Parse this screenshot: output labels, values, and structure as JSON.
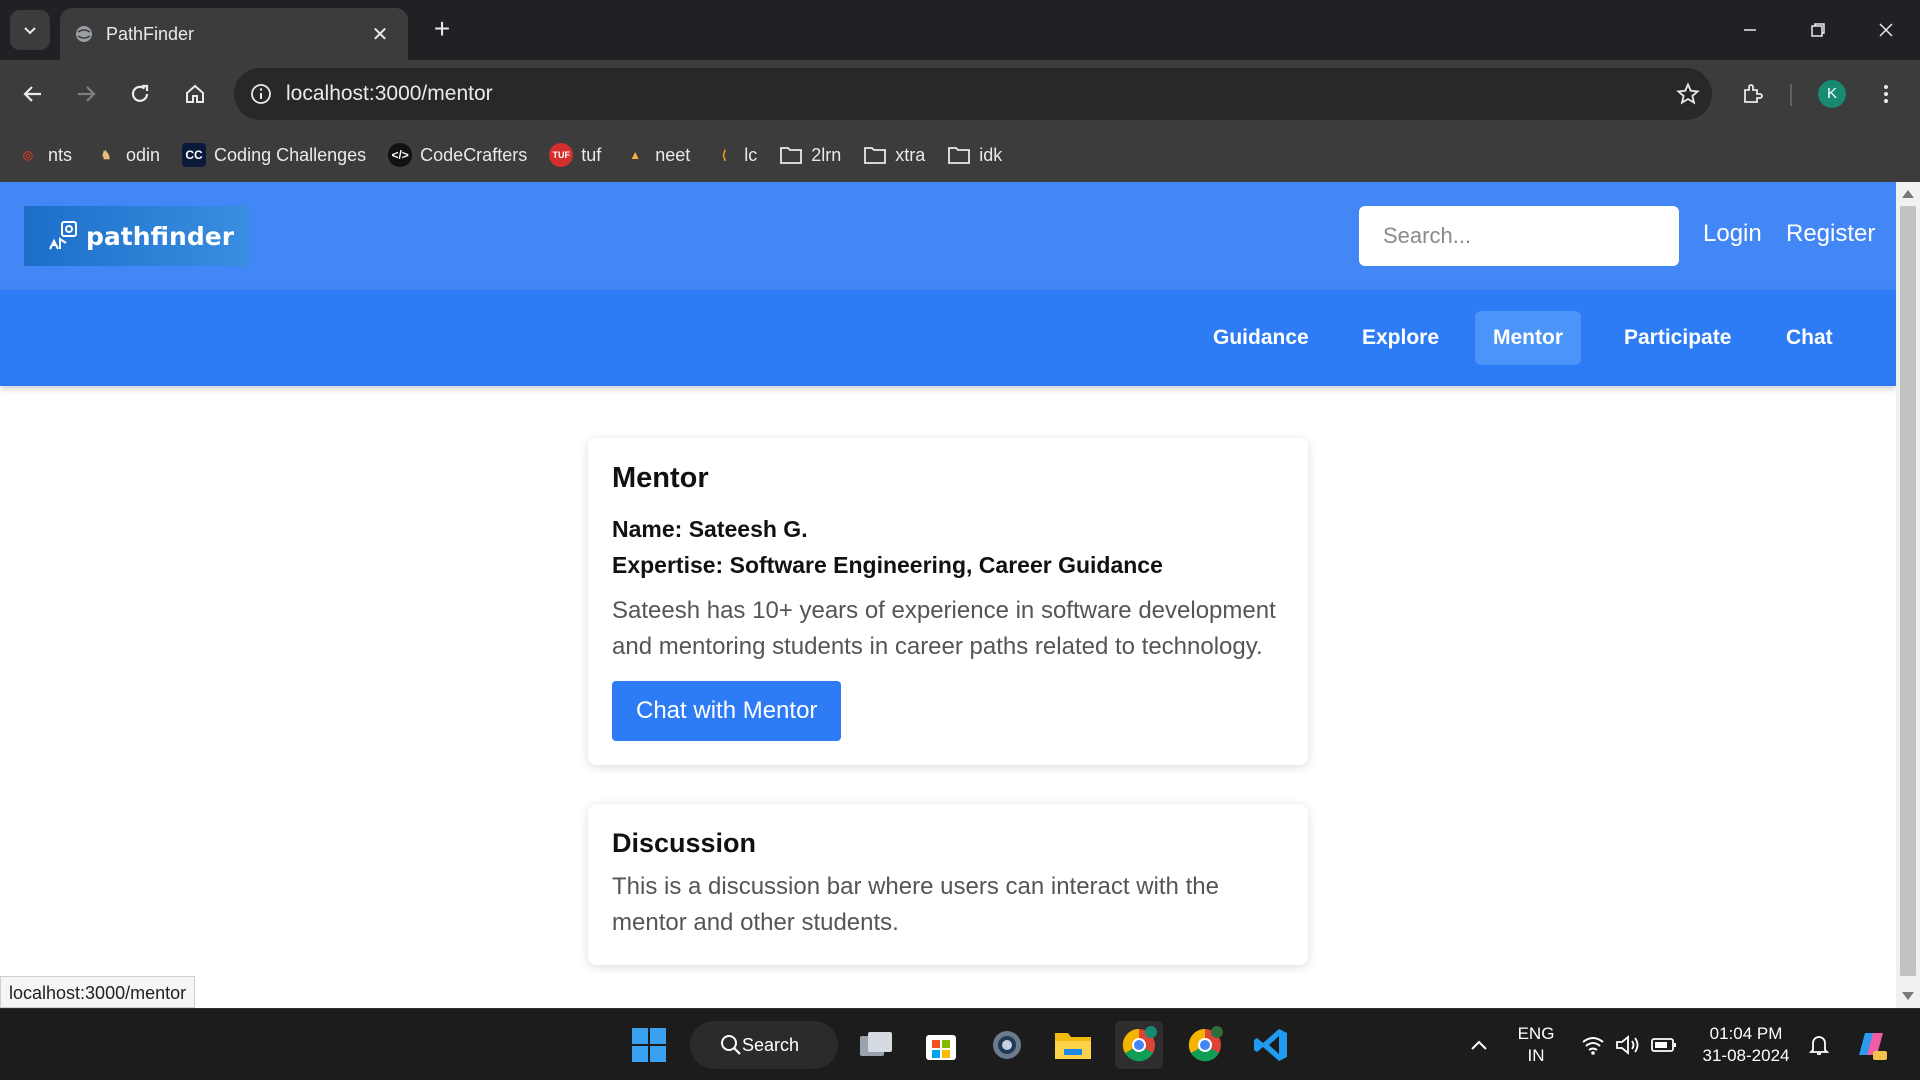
{
  "browser": {
    "tab_title": "PathFinder",
    "url": "localhost:3000/mentor",
    "profile_initial": "K",
    "bookmarks": [
      {
        "label": "nts",
        "icon": "nts-favicon"
      },
      {
        "label": "odin",
        "icon": "odin-favicon"
      },
      {
        "label": "Coding Challenges",
        "icon": "cc-favicon"
      },
      {
        "label": "CodeCrafters",
        "icon": "codecrafters-favicon"
      },
      {
        "label": "tuf",
        "icon": "tuf-favicon"
      },
      {
        "label": "neet",
        "icon": "neet-favicon"
      },
      {
        "label": "lc",
        "icon": "leetcode-favicon"
      },
      {
        "label": "2lrn",
        "icon": "folder-icon"
      },
      {
        "label": "xtra",
        "icon": "folder-icon"
      },
      {
        "label": "idk",
        "icon": "folder-icon"
      }
    ]
  },
  "header": {
    "logo_text": "pathfinder",
    "search_placeholder": "Search...",
    "login_label": "Login",
    "register_label": "Register"
  },
  "nav": {
    "items": [
      {
        "label": "Guidance",
        "active": false
      },
      {
        "label": "Explore",
        "active": false
      },
      {
        "label": "Mentor",
        "active": true
      },
      {
        "label": "Participate",
        "active": false
      },
      {
        "label": "Chat",
        "active": false
      }
    ]
  },
  "mentor_card": {
    "title": "Mentor",
    "name_line": "Name: Sateesh G.",
    "expertise_line": "Expertise: Software Engineering, Career Guidance",
    "description": "Sateesh has 10+ years of experience in software development and mentoring students in career paths related to technology.",
    "button_label": "Chat with Mentor"
  },
  "discussion_card": {
    "title": "Discussion",
    "description": "This is a discussion bar where users can interact with the mentor and other students."
  },
  "status_bar": {
    "hover_url": "localhost:3000/mentor"
  },
  "taskbar": {
    "search_label": "Search",
    "language_line1": "ENG",
    "language_line2": "IN",
    "time": "01:04 PM",
    "date": "31-08-2024"
  },
  "colors": {
    "header_bg": "#4287f5",
    "nav_bg": "#2d7cf6",
    "nav_active_bg": "#4b94f8",
    "button_bg": "#2d7cf6"
  }
}
